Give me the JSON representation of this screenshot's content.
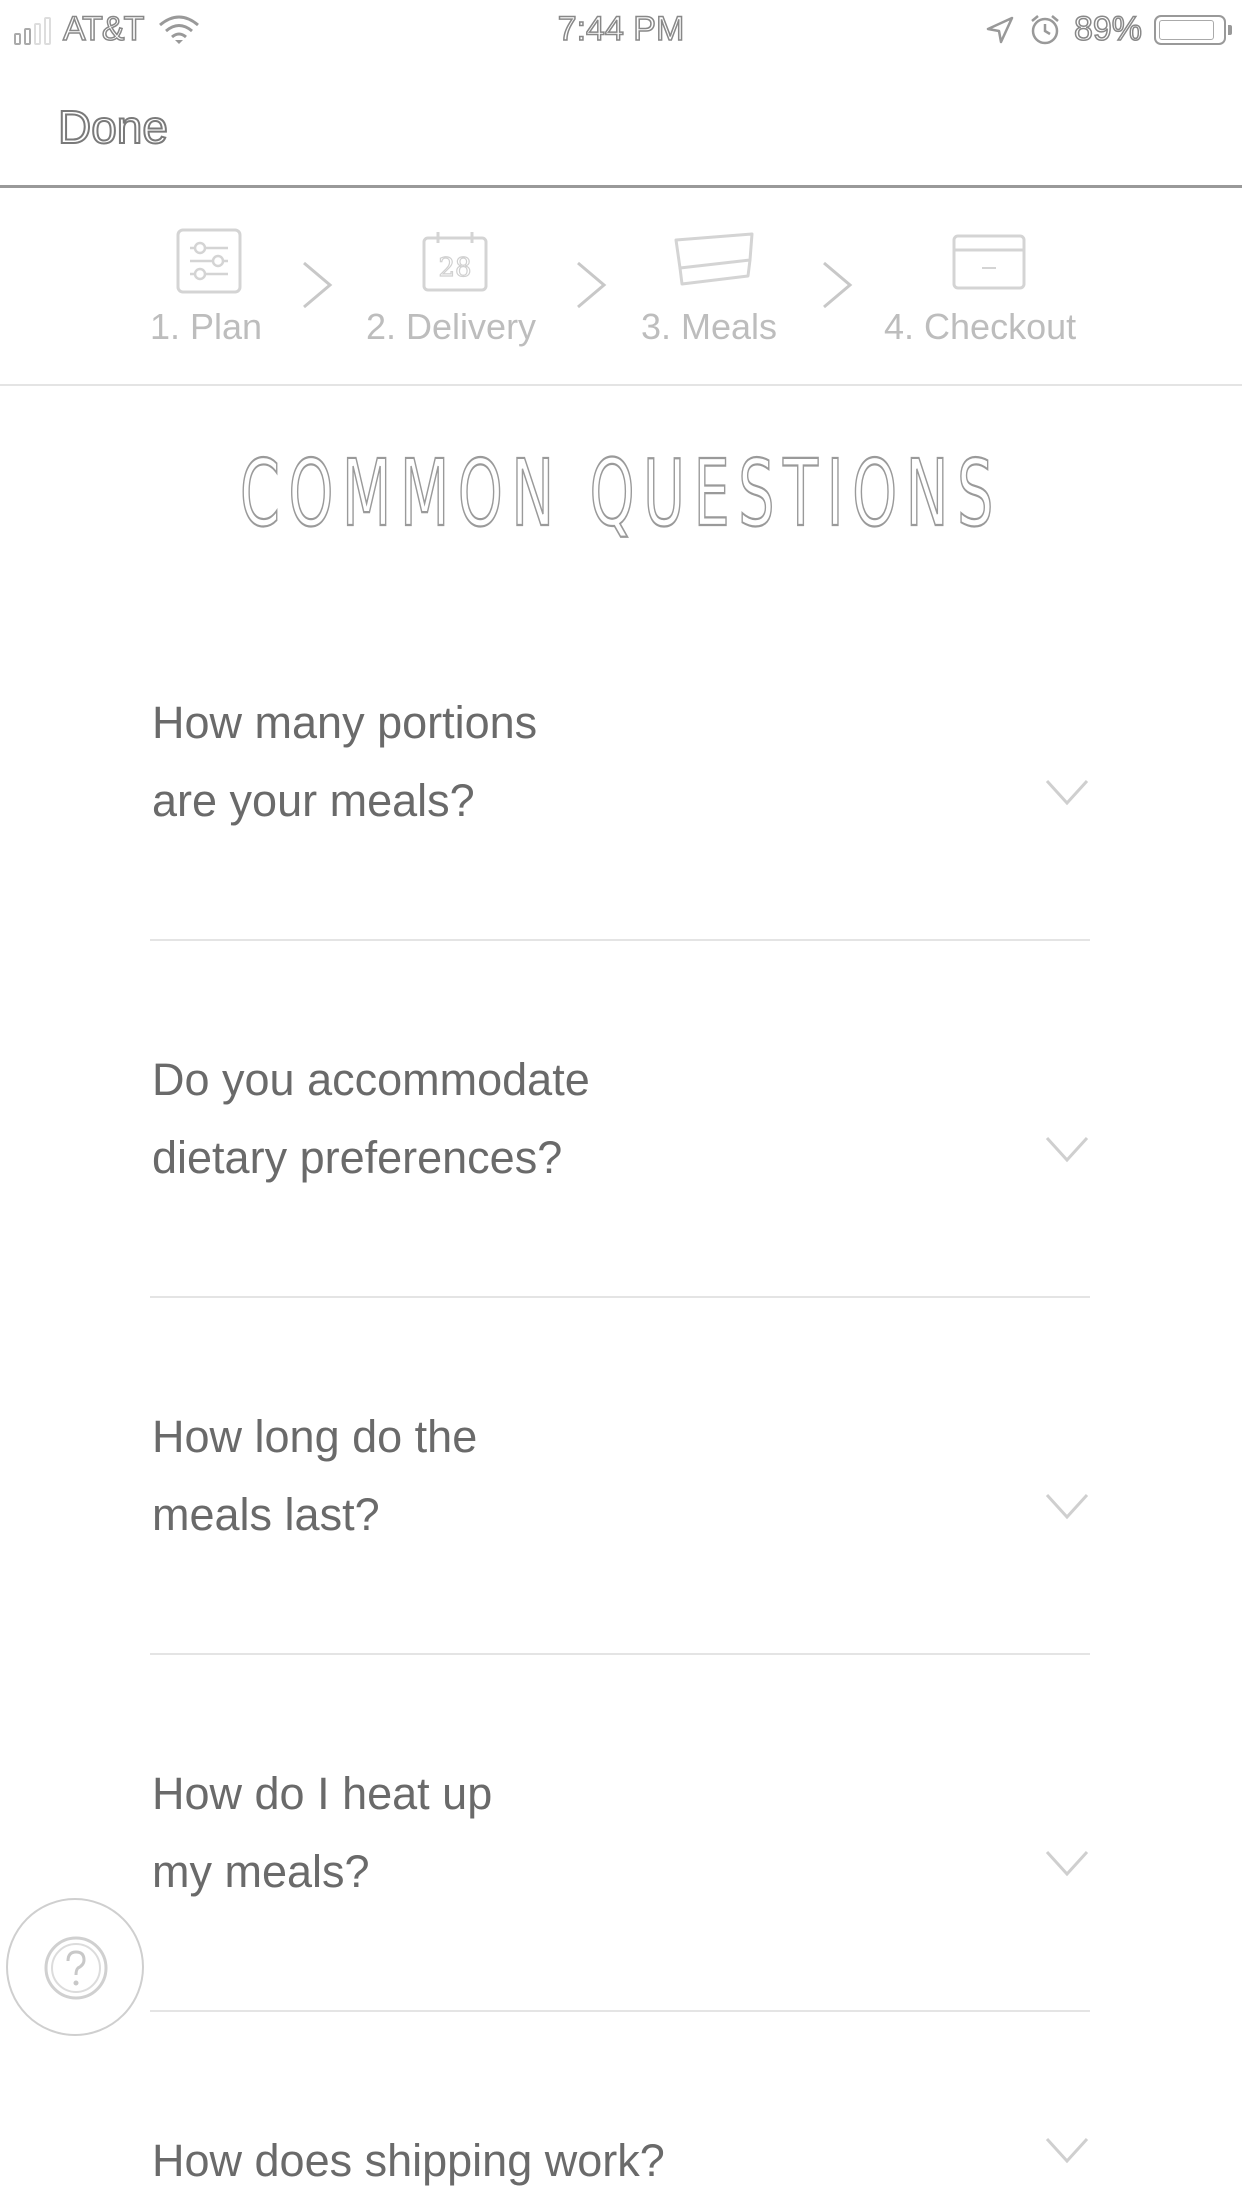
{
  "status_bar": {
    "carrier": "AT&T",
    "time": "7:44 PM",
    "battery_percent": "89%",
    "battery_level": 0.89,
    "icons": [
      "signal-icon",
      "wifi-icon",
      "location-icon",
      "alarm-icon",
      "battery-icon"
    ]
  },
  "nav": {
    "done_label": "Done"
  },
  "steps": [
    {
      "label": "1. Plan",
      "icon": "plan-sliders-icon"
    },
    {
      "label": "2. Delivery",
      "icon": "calendar-icon",
      "icon_text": "28"
    },
    {
      "label": "3. Meals",
      "icon": "meal-tray-icon"
    },
    {
      "label": "4. Checkout",
      "icon": "credit-card-icon"
    }
  ],
  "faq": {
    "title": "COMMON QUESTIONS",
    "items": [
      {
        "line1": "How many portions",
        "line2": "are your meals?"
      },
      {
        "line1": "Do you accommodate",
        "line2": "dietary preferences?"
      },
      {
        "line1": "How long do the",
        "line2": "meals last?"
      },
      {
        "line1": "How do I heat up",
        "line2": "my meals?"
      },
      {
        "line1": "How does shipping work?",
        "line2": ""
      }
    ]
  },
  "help": {
    "icon": "help-question-icon"
  }
}
